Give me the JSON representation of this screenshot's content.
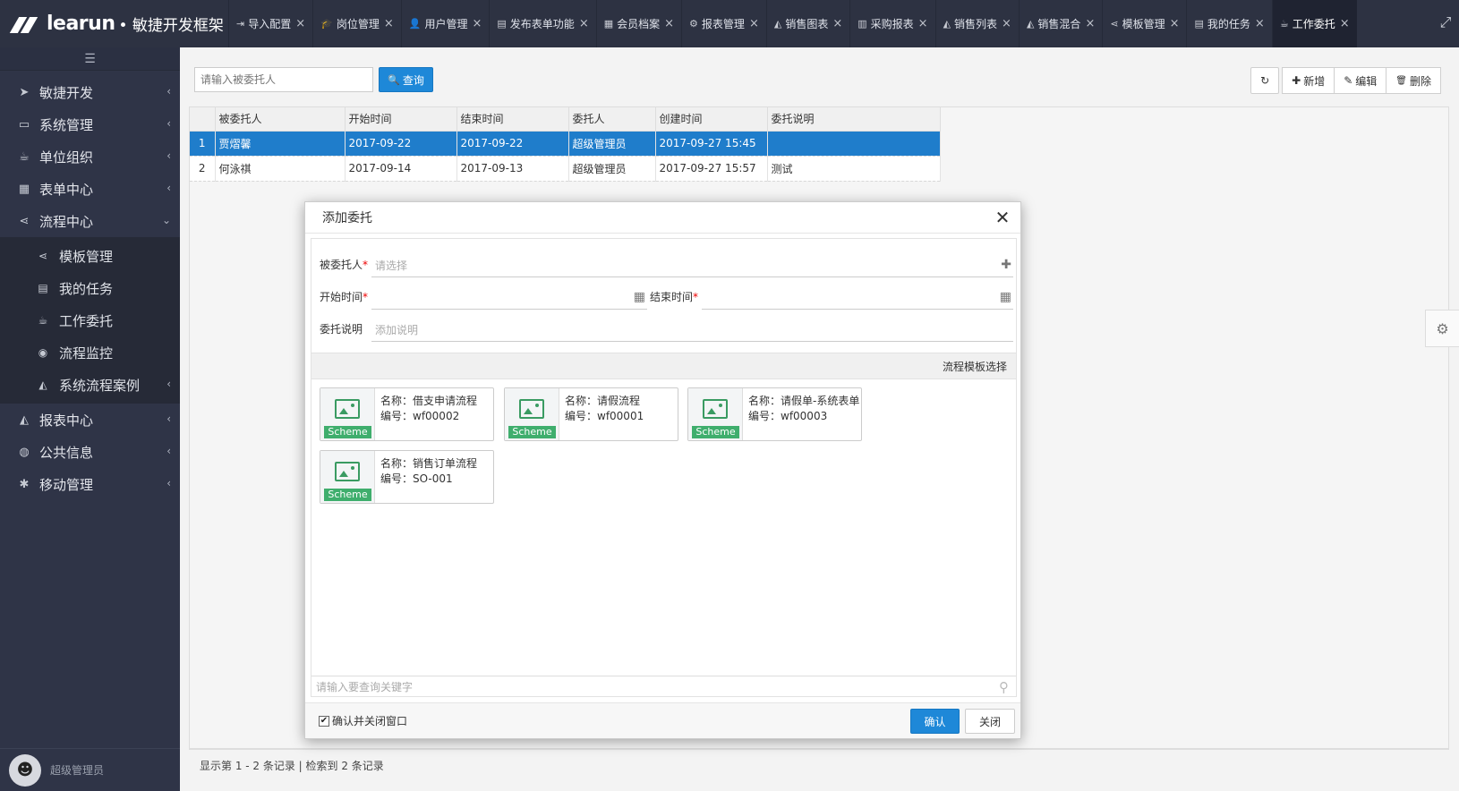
{
  "app": {
    "brand": "learun",
    "tagline": "• 敏捷开发框架"
  },
  "tabs": [
    {
      "icon": "⇥",
      "label": "导入配置"
    },
    {
      "icon": "🎓",
      "label": "岗位管理"
    },
    {
      "icon": "👤",
      "label": "用户管理"
    },
    {
      "icon": "▤",
      "label": "发布表单功能"
    },
    {
      "icon": "▦",
      "label": "会员档案"
    },
    {
      "icon": "⚙",
      "label": "报表管理"
    },
    {
      "icon": "◭",
      "label": "销售图表"
    },
    {
      "icon": "▥",
      "label": "采购报表"
    },
    {
      "icon": "◭",
      "label": "销售列表"
    },
    {
      "icon": "◭",
      "label": "销售混合"
    },
    {
      "icon": "⋖",
      "label": "模板管理"
    },
    {
      "icon": "▤",
      "label": "我的任务"
    },
    {
      "icon": "☕",
      "label": "工作委托"
    }
  ],
  "sidebar": {
    "collapse_icon": "☰",
    "items": [
      {
        "icon": "➤",
        "label": "敏捷开发",
        "arrow": "‹"
      },
      {
        "icon": "▭",
        "label": "系统管理",
        "arrow": "‹"
      },
      {
        "icon": "☕",
        "label": "单位组织",
        "arrow": "‹"
      },
      {
        "icon": "▦",
        "label": "表单中心",
        "arrow": "‹"
      },
      {
        "icon": "⋖",
        "label": "流程中心",
        "arrow": "⌄"
      }
    ],
    "sub_items": [
      {
        "icon": "⋖",
        "label": "模板管理"
      },
      {
        "icon": "▤",
        "label": "我的任务"
      },
      {
        "icon": "☕",
        "label": "工作委托"
      },
      {
        "icon": "◉",
        "label": "流程监控"
      },
      {
        "icon": "◭",
        "label": "系统流程案例",
        "arrow": "‹"
      }
    ],
    "items_after": [
      {
        "icon": "◭",
        "label": "报表中心",
        "arrow": "‹"
      },
      {
        "icon": "◍",
        "label": "公共信息",
        "arrow": "‹"
      },
      {
        "icon": "✱",
        "label": "移动管理",
        "arrow": "‹"
      }
    ],
    "user": "超级管理员"
  },
  "toolbar": {
    "search_placeholder": "请输入被委托人",
    "query_label": "查询",
    "query_icon": "🔍",
    "refresh_icon": "↻",
    "add_label": "新增",
    "add_icon": "✚",
    "edit_label": "编辑",
    "edit_icon": "✎",
    "delete_label": "删除",
    "delete_icon": "🗑"
  },
  "grid": {
    "columns": [
      "",
      "被委托人",
      "开始时间",
      "结束时间",
      "委托人",
      "创建时间",
      "委托说明"
    ],
    "rows": [
      [
        "1",
        "贾熠馨",
        "2017-09-22",
        "2017-09-22",
        "超级管理员",
        "2017-09-27 15:45",
        ""
      ],
      [
        "2",
        "何泳祺",
        "2017-09-14",
        "2017-09-13",
        "超级管理员",
        "2017-09-27 15:57",
        "测试"
      ]
    ],
    "footer": "显示第 1 - 2 条记录 | 检索到 2 条记录"
  },
  "modal": {
    "title": "添加委托",
    "close_icon": "✕",
    "delegate_label": "被委托人",
    "delegate_placeholder": "请选择",
    "add_icon": "✚",
    "start_label": "开始时间",
    "end_label": "结束时间",
    "calendar_icon": "▦",
    "desc_label": "委托说明",
    "desc_placeholder": "添加说明",
    "required_mark": "*",
    "template_bar": "流程模板选择",
    "templates": [
      {
        "name": "名称：借支申请流程",
        "code": "编号：wf00002",
        "tag": "Scheme"
      },
      {
        "name": "名称：请假流程",
        "code": "编号：wf00001",
        "tag": "Scheme"
      },
      {
        "name": "名称：请假单-系统表单",
        "code": "编号：wf00003",
        "tag": "Scheme"
      },
      {
        "name": "名称：销售订单流程",
        "code": "编号：SO-001",
        "tag": "Scheme"
      }
    ],
    "keyword_placeholder": "请输入要查询关键字",
    "search_icon": "⚲",
    "confirm_close_label": "确认并关闭窗口",
    "confirm_checked": "✔",
    "ok_label": "确认",
    "cancel_label": "关闭"
  },
  "misc": {
    "fullscreen_icon": "⤢",
    "gear_icon": "⚙"
  },
  "colors": {
    "accent": "#1e88d8",
    "sidebar": "#2f3447",
    "topbar": "#2d3242",
    "selected_row": "#1f7dcb",
    "scheme_tag": "#3fae6d"
  }
}
